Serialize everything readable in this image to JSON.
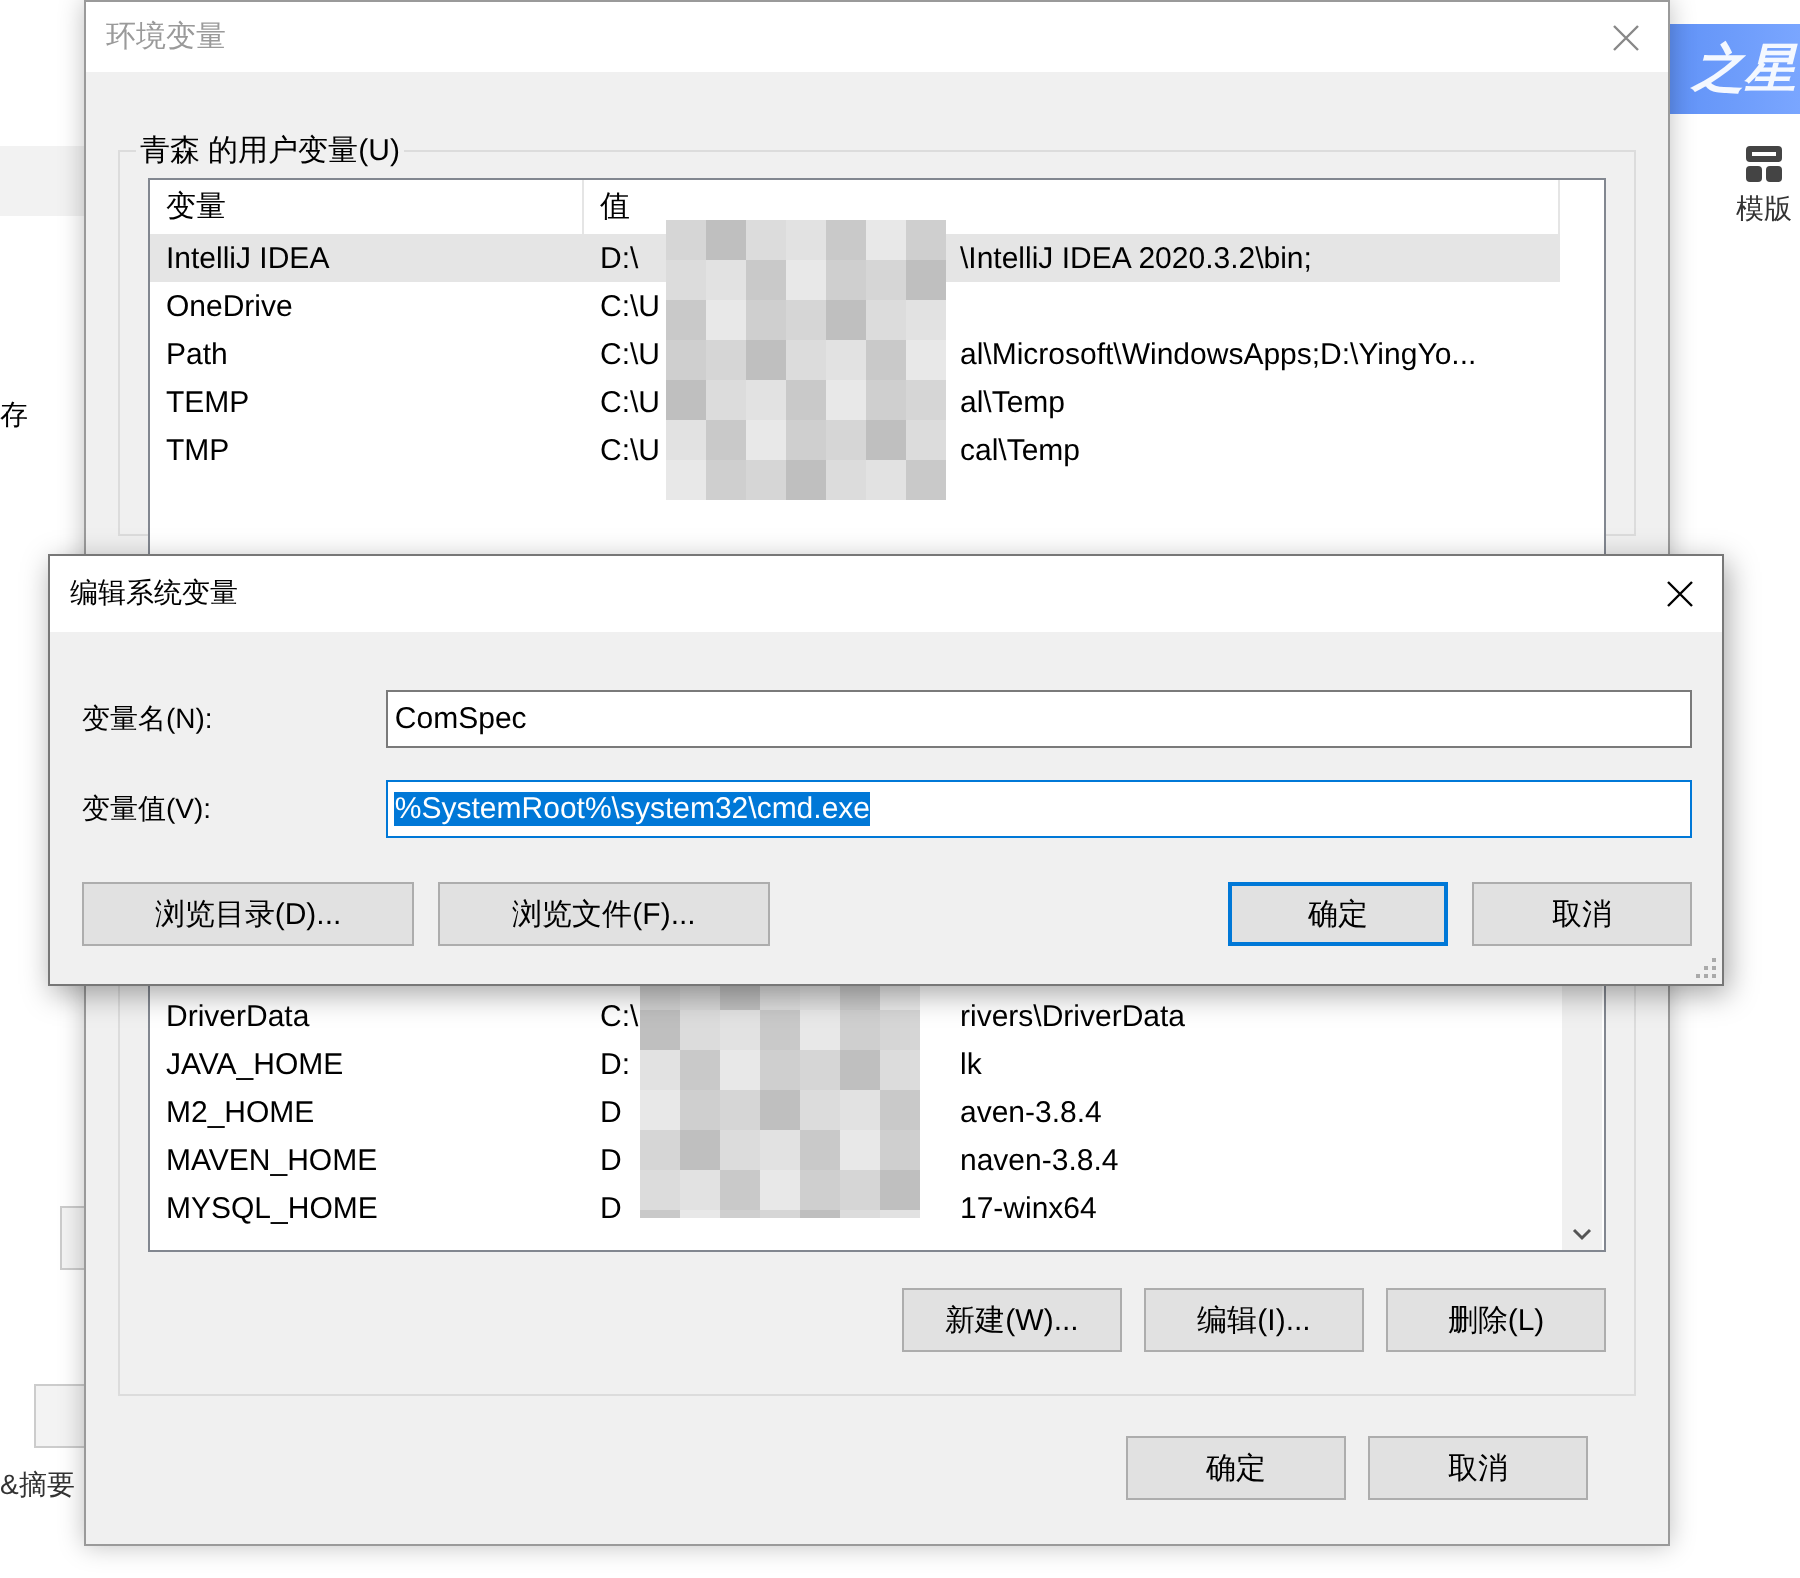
{
  "background_page": {
    "left_texts": [
      "存",
      "&摘要"
    ],
    "banner_text": "之星",
    "toolbar_item": {
      "label": "模版"
    }
  },
  "env_window": {
    "title": "环境变量",
    "active": false,
    "user_group": {
      "label": "青森 的用户变量(U)",
      "columns": [
        "变量",
        "值"
      ]
    },
    "user_rows": [
      {
        "name": "IntelliJ IDEA",
        "value_start": "D:\\",
        "value_end": "\\IntelliJ IDEA 2020.3.2\\bin;",
        "selected": true
      },
      {
        "name": "OneDrive",
        "value_start": "C:\\U",
        "selected": false
      },
      {
        "name": "Path",
        "value_start": "C:\\U",
        "value_end": "al\\Microsoft\\WindowsApps;D:\\YingYo...",
        "selected": false
      },
      {
        "name": "TEMP",
        "value_start": "C:\\U",
        "value_end": "al\\Temp",
        "selected": false
      },
      {
        "name": "TMP",
        "value_start": "C:\\U",
        "value_end": "cal\\Temp",
        "selected": false
      }
    ],
    "system_rows": [
      {
        "name": "DriverData",
        "value_start": "C:\\",
        "value_end": "rivers\\DriverData",
        "selected": false
      },
      {
        "name": "JAVA_HOME",
        "value_start": "D:",
        "value_end": "lk",
        "selected": false
      },
      {
        "name": "M2_HOME",
        "value_start": "D",
        "value_end": "aven-3.8.4",
        "selected": false
      },
      {
        "name": "MAVEN_HOME",
        "value_start": "D",
        "value_end": "naven-3.8.4",
        "selected": false
      },
      {
        "name": "MYSQL_HOME",
        "value_start": "D",
        "value_end": "17-winx64",
        "selected": false
      }
    ],
    "system_buttons": [
      "新建(W)...",
      "编辑(I)...",
      "删除(L)"
    ],
    "buttons": [
      "确定",
      "取消"
    ]
  },
  "edit_dialog": {
    "title": "编辑系统变量",
    "fields": [
      {
        "label": "变量名(N):",
        "value": "ComSpec",
        "focused": false
      },
      {
        "label": "变量值(V):",
        "value": "%SystemRoot%\\system32\\cmd.exe",
        "focused": true
      }
    ],
    "left_buttons": [
      "浏览目录(D)...",
      "浏览文件(F)..."
    ],
    "buttons": [
      {
        "label": "确定",
        "default": true
      },
      {
        "label": "取消",
        "default": false
      }
    ]
  }
}
